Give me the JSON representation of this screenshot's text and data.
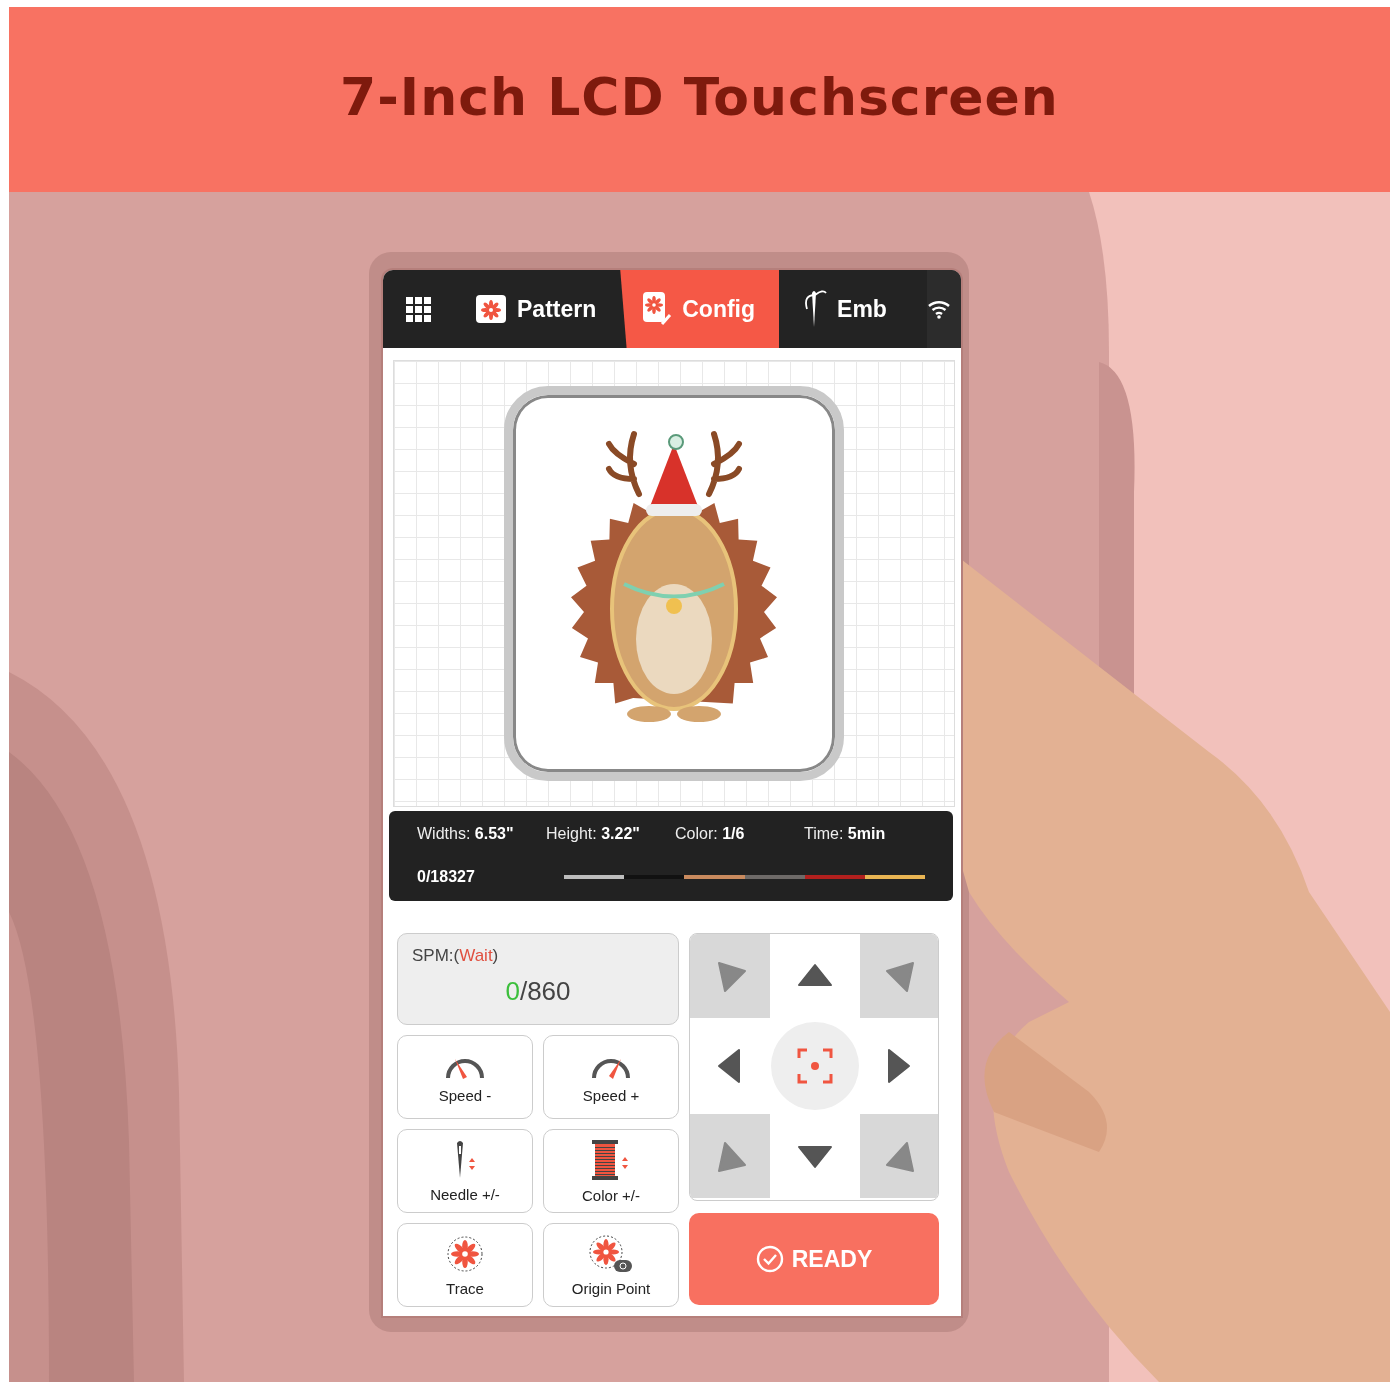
{
  "banner": {
    "title": "7-Inch LCD Touchscreen"
  },
  "tabs": [
    {
      "label": "Pattern",
      "kind": "pattern",
      "selected": false
    },
    {
      "label": "Config",
      "kind": "config",
      "selected": true
    },
    {
      "label": "Emb",
      "kind": "needle",
      "selected": false
    }
  ],
  "design_info": {
    "widths": "Widths: **6.53\"**",
    "height": "Height: **3.22\"**",
    "color_count": "Color: **1/6**",
    "time": "Time: **5min**",
    "stitches": "0/18327",
    "threads": [
      {
        "color": "#bdbdbd"
      },
      {
        "color": "#111111"
      },
      {
        "color": "#c98a5e"
      },
      {
        "color": "#6e6a68"
      },
      {
        "color": "#b3201e"
      },
      {
        "color": "#e9b553"
      }
    ]
  },
  "spm": {
    "label_start": "SPM:(",
    "status": "Wait",
    "label_end": ")",
    "current": "0",
    "max": "/860"
  },
  "controls": [
    {
      "kind": "speed-down",
      "label": "Speed -"
    },
    {
      "kind": "speed-up",
      "label": "Speed +"
    },
    {
      "kind": "needle",
      "label": "Needle +/-"
    },
    {
      "kind": "color",
      "label": "Color +/-"
    },
    {
      "kind": "trace",
      "label": "Trace"
    },
    {
      "kind": "origin",
      "label": "Origin Point"
    }
  ],
  "ready_button": {
    "label": "READY"
  }
}
